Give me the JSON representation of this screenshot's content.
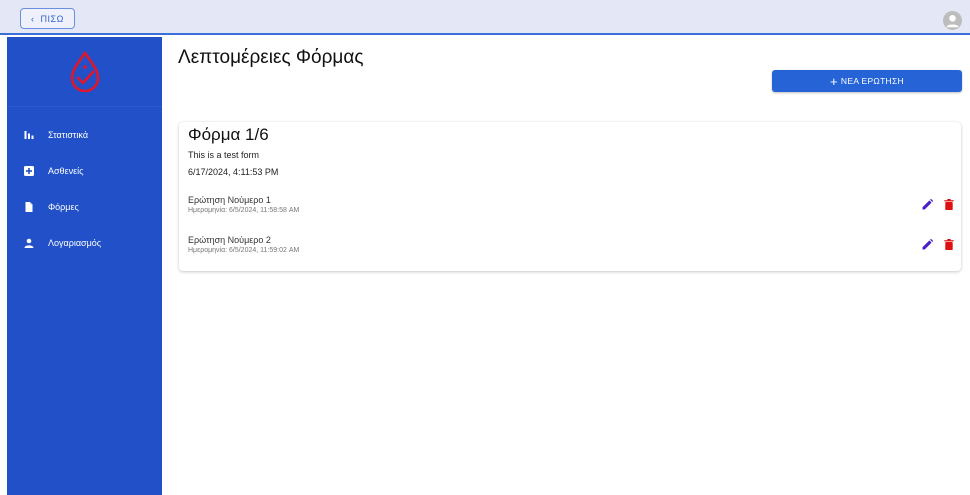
{
  "topbar": {
    "back_label": "ΠΙΣΩ",
    "back_icon": "chevron-left-icon",
    "avatar_icon": "account-circle-icon"
  },
  "sidebar": {
    "logo": "blood-drop-check-logo",
    "items": [
      {
        "label": "Στατιστικά",
        "icon": "bar-chart-icon"
      },
      {
        "label": "Ασθενείς",
        "icon": "plus-box-icon"
      },
      {
        "label": "Φόρμες",
        "icon": "file-icon"
      },
      {
        "label": "Λογαριασμός",
        "icon": "person-icon"
      }
    ]
  },
  "main": {
    "title": "Λεπτομέρειες Φόρμας",
    "new_question_label": "ΝΕΑ ΕΡΩΤΗΣΗ"
  },
  "form": {
    "title": "Φόρμα 1/6",
    "description": "This is a test form",
    "date": "6/17/2024, 4:11:53 PM",
    "questions": [
      {
        "title": "Ερώτηση Νούμερο 1",
        "date": "Ημερομηνία: 6/5/2024, 11:58:58 AM"
      },
      {
        "title": "Ερώτηση Νούμερο 2",
        "date": "Ημερομηνία: 6/5/2024, 11:59:02 AM"
      }
    ]
  },
  "colors": {
    "sidebar": "#2150c8",
    "primary": "#2563d6",
    "edit": "#4a21c9",
    "delete": "#e01010",
    "logo": "#e0162b"
  }
}
